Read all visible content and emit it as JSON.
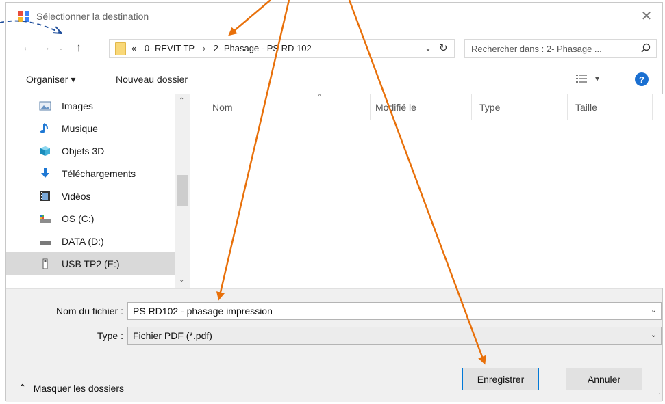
{
  "window": {
    "title": "Sélectionner la destination",
    "close_glyph": "✕",
    "icon": "dialog-app-icon"
  },
  "nav": {
    "back_glyph": "←",
    "forward_glyph": "→",
    "history_glyph": "⌄",
    "up_glyph": "↑"
  },
  "address": {
    "overflow": "«",
    "crumbs": [
      "0- REVIT TP",
      "2- Phasage - PS RD 102"
    ],
    "separator": "›",
    "dropdown_glyph": "⌄",
    "refresh_glyph": "↻"
  },
  "search": {
    "placeholder": "Rechercher dans : 2- Phasage ..."
  },
  "toolbar": {
    "organise_label": "Organiser ▾",
    "new_folder_label": "Nouveau dossier",
    "view_dropdown": "▾",
    "help_label": "?"
  },
  "sidebar": {
    "items": [
      {
        "label": "Images",
        "icon": "pictures-icon"
      },
      {
        "label": "Musique",
        "icon": "music-icon"
      },
      {
        "label": "Objets 3D",
        "icon": "3d-objects-icon"
      },
      {
        "label": "Téléchargements",
        "icon": "downloads-icon"
      },
      {
        "label": "Vidéos",
        "icon": "videos-icon"
      },
      {
        "label": "OS (C:)",
        "icon": "system-drive-icon"
      },
      {
        "label": "DATA (D:)",
        "icon": "drive-icon"
      },
      {
        "label": "USB TP2 (E:)",
        "icon": "usb-drive-icon",
        "selected": true
      }
    ],
    "scroll_up": "⌃",
    "scroll_down": "⌄"
  },
  "filelist": {
    "columns": [
      "Nom",
      "Modifié le",
      "Type",
      "Taille"
    ],
    "sort_glyph": "^"
  },
  "form": {
    "filename_label": "Nom du fichier :",
    "filename_value": "PS RD102 - phasage impression",
    "type_label": "Type :",
    "type_value": "Fichier PDF (*.pdf)",
    "dropdown_glyph": "⌄",
    "toggle_label": "Masquer les dossiers",
    "toggle_glyph": "⌃",
    "save_label": "Enregistrer",
    "cancel_label": "Annuler"
  },
  "colors": {
    "annotation_arrow": "#e8700a",
    "annotation_dashed": "#1f4e9c",
    "accent": "#0078d7",
    "help_blue": "#1a6fd1"
  }
}
